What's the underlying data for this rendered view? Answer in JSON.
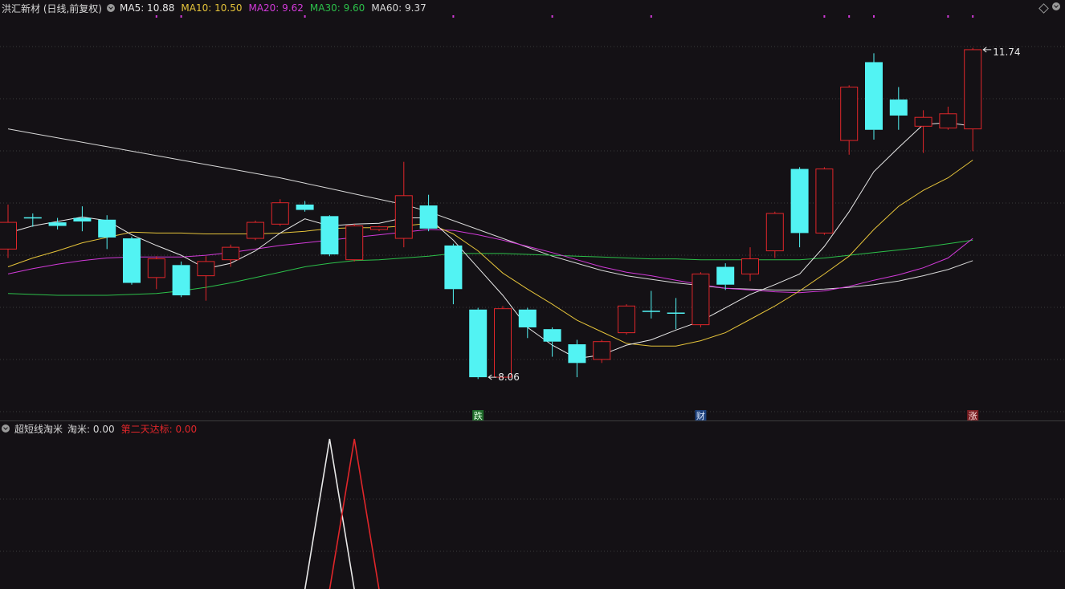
{
  "header": {
    "stock_title": "洪汇新材 (日线,前复权)",
    "ma_labels": [
      {
        "text": "MA5: 10.88",
        "color": "#e8e8e8"
      },
      {
        "text": "MA10: 10.50",
        "color": "#e5c33a"
      },
      {
        "text": "MA20: 9.62",
        "color": "#d23ad9"
      },
      {
        "text": "MA30: 9.60",
        "color": "#2cc04a"
      },
      {
        "text": "MA60: 9.37",
        "color": "#d8d8d8"
      }
    ]
  },
  "indicator": {
    "name": "超短线淘米",
    "value_a": "淘米: 0.00",
    "value_b": "第二天达标: 0.00",
    "value_a_color": "#d8d8d8",
    "value_b_color": "#e0262a"
  },
  "colors": {
    "up": "#e0262a",
    "down": "#52f3f3",
    "background": "#141115",
    "grid": "#3a3a3a",
    "ma5": "#e8e8e8",
    "ma10": "#e5c33a",
    "ma20": "#d23ad9",
    "ma30": "#2cc04a",
    "ma60": "#d8d8d8",
    "marker_dots": "#d23ad9"
  },
  "chart_data": {
    "type": "candlestick",
    "ylim": [
      7.7,
      12.1
    ],
    "candles": [
      {
        "o": 9.5,
        "c": 9.8,
        "h": 10.0,
        "l": 9.4
      },
      {
        "o": 9.85,
        "c": 9.85,
        "h": 9.9,
        "l": 9.75
      },
      {
        "o": 9.8,
        "c": 9.76,
        "h": 9.85,
        "l": 9.72
      },
      {
        "o": 9.85,
        "c": 9.81,
        "h": 9.98,
        "l": 9.7
      },
      {
        "o": 9.83,
        "c": 9.63,
        "h": 9.88,
        "l": 9.5
      },
      {
        "o": 9.62,
        "c": 9.12,
        "h": 9.64,
        "l": 9.1
      },
      {
        "o": 9.18,
        "c": 9.39,
        "h": 9.42,
        "l": 9.05
      },
      {
        "o": 9.32,
        "c": 8.98,
        "h": 9.36,
        "l": 8.96
      },
      {
        "o": 9.2,
        "c": 9.36,
        "h": 9.42,
        "l": 8.92
      },
      {
        "o": 9.38,
        "c": 9.52,
        "h": 9.55,
        "l": 9.3
      },
      {
        "o": 9.62,
        "c": 9.8,
        "h": 9.82,
        "l": 9.6
      },
      {
        "o": 9.78,
        "c": 10.02,
        "h": 10.06,
        "l": 9.76
      },
      {
        "o": 10.0,
        "c": 9.94,
        "h": 10.04,
        "l": 9.92
      },
      {
        "o": 9.87,
        "c": 9.44,
        "h": 9.88,
        "l": 9.42
      },
      {
        "o": 9.38,
        "c": 9.76,
        "h": 9.78,
        "l": 9.36
      },
      {
        "o": 9.72,
        "c": 9.75,
        "h": 9.76,
        "l": 9.7
      },
      {
        "o": 9.62,
        "c": 10.1,
        "h": 10.48,
        "l": 9.52
      },
      {
        "o": 9.99,
        "c": 9.73,
        "h": 10.11,
        "l": 9.7
      },
      {
        "o": 9.54,
        "c": 9.05,
        "h": 9.56,
        "l": 8.88
      },
      {
        "o": 8.82,
        "c": 8.06,
        "h": 8.84,
        "l": 8.04
      },
      {
        "o": 8.06,
        "c": 8.83,
        "h": 8.86,
        "l": 8.04
      },
      {
        "o": 8.82,
        "c": 8.62,
        "h": 8.84,
        "l": 8.5
      },
      {
        "o": 8.6,
        "c": 8.46,
        "h": 8.62,
        "l": 8.29
      },
      {
        "o": 8.43,
        "c": 8.22,
        "h": 8.48,
        "l": 8.06
      },
      {
        "o": 8.26,
        "c": 8.46,
        "h": 8.48,
        "l": 8.22
      },
      {
        "o": 8.56,
        "c": 8.86,
        "h": 8.88,
        "l": 8.54
      },
      {
        "o": 8.8,
        "c": 8.8,
        "h": 9.03,
        "l": 8.72
      },
      {
        "o": 8.78,
        "c": 8.78,
        "h": 8.95,
        "l": 8.6
      },
      {
        "o": 8.65,
        "c": 9.22,
        "h": 9.24,
        "l": 8.62
      },
      {
        "o": 9.3,
        "c": 9.1,
        "h": 9.34,
        "l": 9.04
      },
      {
        "o": 9.22,
        "c": 9.39,
        "h": 9.52,
        "l": 9.14
      },
      {
        "o": 9.48,
        "c": 9.9,
        "h": 9.92,
        "l": 9.4
      },
      {
        "o": 10.4,
        "c": 9.68,
        "h": 10.42,
        "l": 9.52
      },
      {
        "o": 9.68,
        "c": 10.4,
        "h": 10.42,
        "l": 9.66
      },
      {
        "o": 10.72,
        "c": 11.32,
        "h": 11.34,
        "l": 10.56
      },
      {
        "o": 11.6,
        "c": 10.84,
        "h": 11.7,
        "l": 10.73
      },
      {
        "o": 11.18,
        "c": 11.0,
        "h": 11.32,
        "l": 10.84
      },
      {
        "o": 10.88,
        "c": 10.98,
        "h": 11.06,
        "l": 10.58
      },
      {
        "o": 10.86,
        "c": 11.02,
        "h": 11.1,
        "l": 10.84
      },
      {
        "o": 10.85,
        "c": 11.74,
        "h": 11.76,
        "l": 10.6
      }
    ],
    "ma5": [
      9.68,
      9.76,
      9.81,
      9.86,
      9.82,
      9.66,
      9.54,
      9.43,
      9.28,
      9.34,
      9.48,
      9.68,
      9.84,
      9.76,
      9.78,
      9.79,
      9.85,
      9.85,
      9.6,
      9.29,
      8.98,
      8.62,
      8.42,
      8.27,
      8.31,
      8.42,
      8.48,
      8.59,
      8.69,
      8.84,
      8.99,
      9.1,
      9.22,
      9.53,
      9.92,
      10.37,
      10.64,
      10.9,
      10.92,
      10.88
    ],
    "ma10": [
      9.3,
      9.4,
      9.48,
      9.57,
      9.63,
      9.69,
      9.68,
      9.68,
      9.67,
      9.67,
      9.67,
      9.68,
      9.7,
      9.73,
      9.74,
      9.74,
      9.76,
      9.79,
      9.67,
      9.48,
      9.23,
      9.05,
      8.88,
      8.7,
      8.57,
      8.44,
      8.41,
      8.41,
      8.47,
      8.56,
      8.71,
      8.86,
      9.03,
      9.22,
      9.42,
      9.72,
      9.98,
      10.16,
      10.3,
      10.5
    ],
    "ma20": [
      9.22,
      9.28,
      9.33,
      9.37,
      9.4,
      9.41,
      9.41,
      9.41,
      9.43,
      9.46,
      9.5,
      9.54,
      9.57,
      9.6,
      9.63,
      9.66,
      9.69,
      9.72,
      9.71,
      9.66,
      9.6,
      9.53,
      9.46,
      9.38,
      9.3,
      9.24,
      9.2,
      9.15,
      9.1,
      9.06,
      9.04,
      9.02,
      9.01,
      9.03,
      9.08,
      9.15,
      9.21,
      9.29,
      9.4,
      9.62
    ],
    "ma30": [
      9.0,
      8.99,
      8.98,
      8.98,
      8.98,
      8.99,
      9.0,
      9.03,
      9.07,
      9.12,
      9.18,
      9.24,
      9.3,
      9.34,
      9.37,
      9.38,
      9.4,
      9.42,
      9.45,
      9.45,
      9.45,
      9.44,
      9.43,
      9.42,
      9.41,
      9.4,
      9.39,
      9.39,
      9.38,
      9.38,
      9.38,
      9.38,
      9.38,
      9.4,
      9.43,
      9.46,
      9.49,
      9.52,
      9.56,
      9.6
    ],
    "ma60": [
      10.85,
      10.8,
      10.75,
      10.7,
      10.65,
      10.6,
      10.55,
      10.5,
      10.45,
      10.4,
      10.35,
      10.3,
      10.24,
      10.18,
      10.12,
      10.06,
      10.0,
      9.92,
      9.82,
      9.72,
      9.62,
      9.52,
      9.42,
      9.34,
      9.26,
      9.2,
      9.16,
      9.12,
      9.09,
      9.06,
      9.05,
      9.04,
      9.04,
      9.05,
      9.07,
      9.1,
      9.14,
      9.2,
      9.27,
      9.37
    ],
    "price_labels": [
      {
        "index": 19,
        "value": 8.06,
        "text": "8.06",
        "side": "low"
      },
      {
        "index": 39,
        "value": 11.74,
        "text": "11.74",
        "side": "high"
      }
    ],
    "event_markers": [
      {
        "index": 19,
        "text": "跌",
        "bg": "#1f6a2a",
        "color": "#e0ffe0"
      },
      {
        "index": 28,
        "text": "财",
        "bg": "#1c3f7a",
        "color": "#e0ecff"
      },
      {
        "index": 39,
        "text": "涨",
        "bg": "#7a1e22",
        "color": "#ffe0e0"
      }
    ],
    "top_dots": [
      6,
      7,
      12,
      18,
      22,
      26,
      33,
      34,
      35,
      38,
      39
    ],
    "indicator_series": [
      {
        "name": "淘米",
        "color": "#e8e8e8",
        "peak_index": 13,
        "value": 0.0
      },
      {
        "name": "第二天达标",
        "color": "#e0262a",
        "peak_index": 14,
        "value": 0.0
      }
    ]
  }
}
